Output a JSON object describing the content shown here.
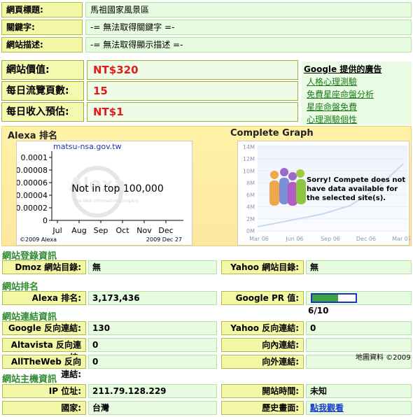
{
  "meta": {
    "title_label": "網頁標題:",
    "title_value": "馬祖國家風景區",
    "keywords_label": "關鍵字:",
    "keywords_value": "-= 無法取得關鍵字 =-",
    "desc_label": "網站描述:",
    "desc_value": "-= 無法取得顯示描述 =-"
  },
  "stats": {
    "worth_label": "網站價值:",
    "worth_value": "NT$320",
    "pageviews_label": "每日流覽頁數:",
    "pageviews_value": "15",
    "income_label": "每日收入預估:",
    "income_value": "NT$1"
  },
  "ads": {
    "title": "Google 提供的廣告",
    "links": [
      "人格心理測驗",
      "免費星座命盤分析",
      "星座命盤免費",
      "心理測驗個性"
    ]
  },
  "alexa_graph": {
    "title": "Alexa 排名",
    "site": "matsu-nsa.gov.tw",
    "y_ticks": [
      "0.0001",
      "0.00008",
      "0.00006",
      "0.00004",
      "0.00002",
      "0"
    ],
    "x_ticks": [
      "Jul",
      "Aug",
      "Sep",
      "Oct",
      "Nov",
      "Dec"
    ],
    "overlay_text": "Not in top 100,000",
    "watermark": "The Web Information Company",
    "copyright": "©2009 Alexa",
    "date": "2009  Dec 27"
  },
  "compete_graph": {
    "title": "Complete Graph",
    "y_ticks": [
      "14M",
      "12M",
      "10M",
      "8M",
      "6M",
      "4M",
      "2M",
      "0M"
    ],
    "x_ticks": [
      "Mar 06",
      "Jun 06",
      "Sep 06",
      "Dec 06",
      "Mar 07"
    ],
    "sorry_lines": [
      "Sorry! Compete does not",
      "have data available for",
      "the selected site(s)."
    ]
  },
  "registration": {
    "heading": "網站登錄資訊",
    "dmoz_label": "Dmoz 網站目錄:",
    "dmoz_value": "無",
    "yahoo_label": "Yahoo 網站目錄:",
    "yahoo_value": "無"
  },
  "ranking": {
    "heading": "網站排名",
    "alexa_label": "Alexa 排名:",
    "alexa_value": "3,173,436",
    "pr_label": "Google PR 值:",
    "pr_value": "6/10",
    "pr_fraction": 0.6
  },
  "links": {
    "heading": "網站連結資訊",
    "google_label": "Google 反向連結:",
    "google_value": "130",
    "yahoo_label": "Yahoo 反向連結:",
    "yahoo_value": "0",
    "altavista_label": "Altavista 反向連結:",
    "altavista_value": "0",
    "inbound_label": "向內連結:",
    "inbound_value": "",
    "alltheweb_label": "AllTheWeb 反向連結:",
    "alltheweb_value": "0",
    "outbound_label": "向外連結:",
    "outbound_value": "",
    "map_credit": "地圖資料 ©2009"
  },
  "host": {
    "heading": "網站主機資訊",
    "ip_label": "IP 位址:",
    "ip_value": "211.79.128.229",
    "opened_label": "開站時間:",
    "opened_value": "未知",
    "country_label": "國家:",
    "country_value": "台灣",
    "history_label": "歷史畫面:",
    "history_link": "點我觀看"
  }
}
